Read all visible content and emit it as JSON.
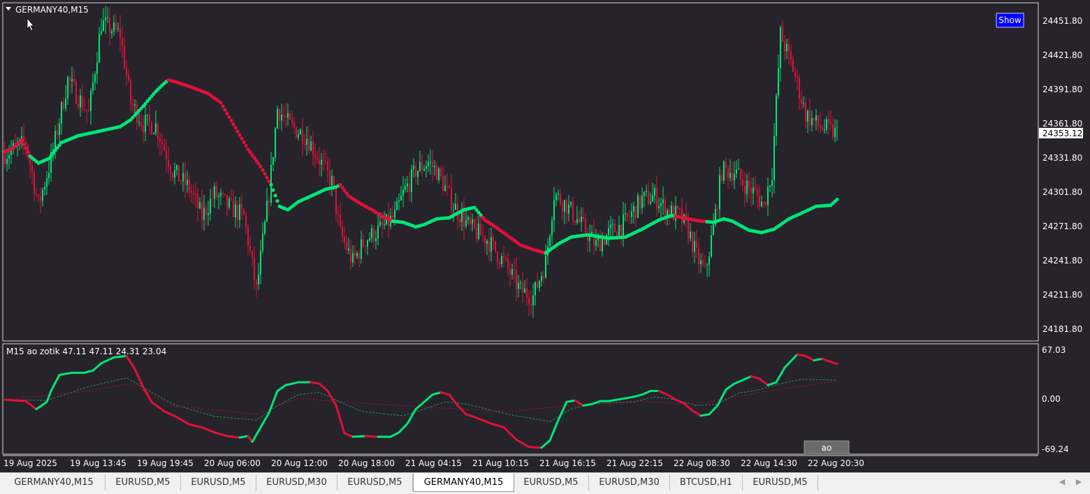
{
  "window": {
    "symbol_label": "GERMANY40,M15",
    "show_button": "Show"
  },
  "main_panel": {
    "price_labels": [
      "24451.80",
      "24421.80",
      "24391.80",
      "24361.80",
      "24331.80",
      "24301.80",
      "24271.80",
      "24241.80",
      "24211.80",
      "24181.80"
    ],
    "current_price": "24353.12"
  },
  "sub_panel": {
    "indicator_label": "M15 ao zotik  47.11 47.11 24.31 23.04",
    "axis_labels": [
      "67.03",
      "0.00",
      "-69.24"
    ],
    "ao_button": "ao"
  },
  "time_axis": [
    "19 Aug 2025",
    "19 Aug 13:45",
    "19 Aug 19:45",
    "20 Aug 06:00",
    "20 Aug 12:00",
    "20 Aug 18:00",
    "21 Aug 04:15",
    "21 Aug 10:15",
    "21 Aug 16:15",
    "21 Aug 22:15",
    "22 Aug 08:30",
    "22 Aug 14:30",
    "22 Aug 20:30"
  ],
  "tabs": [
    "GERMANY40,M15",
    "EURUSD,M5",
    "EURUSD,M5",
    "EURUSD,M30",
    "EURUSD,M5",
    "GERMANY40,M15",
    "EURUSD,M5",
    "EURUSD,M30",
    "BTCUSD,H1",
    "EURUSD,M5"
  ],
  "active_tab_index": 5,
  "colors": {
    "background": "#26232b",
    "bull": "#00e676",
    "bear": "#e0103a",
    "axis_text": "#ffffff",
    "show_button": "#0000ff"
  },
  "chart_data": {
    "type": "line",
    "instrument": "GERMANY40,M15",
    "y_range": [
      24170,
      24465
    ],
    "price_trendline": {
      "points": [
        [
          0,
          24337
        ],
        [
          4,
          24340
        ],
        [
          8,
          24347
        ],
        [
          12,
          24333
        ],
        [
          16,
          24327
        ],
        [
          21,
          24331
        ],
        [
          27,
          24345
        ],
        [
          35,
          24351
        ],
        [
          45,
          24355
        ],
        [
          55,
          24359
        ],
        [
          60,
          24365
        ],
        [
          66,
          24377
        ],
        [
          72,
          24390
        ],
        [
          76,
          24397
        ],
        [
          78,
          24400
        ],
        [
          82,
          24398
        ],
        [
          90,
          24393
        ],
        [
          97,
          24388
        ],
        [
          103,
          24380
        ],
        [
          110,
          24358
        ],
        [
          116,
          24339
        ],
        [
          122,
          24324
        ],
        [
          127,
          24308
        ],
        [
          131,
          24289
        ],
        [
          135,
          24286
        ],
        [
          140,
          24293
        ],
        [
          146,
          24298
        ],
        [
          153,
          24304
        ],
        [
          158,
          24306
        ],
        [
          160,
          24308
        ],
        [
          164,
          24298
        ],
        [
          170,
          24291
        ],
        [
          176,
          24285
        ],
        [
          180,
          24280
        ],
        [
          185,
          24276
        ],
        [
          190,
          24275
        ],
        [
          196,
          24271
        ],
        [
          200,
          24273
        ],
        [
          206,
          24278
        ],
        [
          212,
          24279
        ],
        [
          219,
          24286
        ],
        [
          224,
          24288
        ],
        [
          229,
          24277
        ],
        [
          234,
          24271
        ],
        [
          240,
          24263
        ],
        [
          246,
          24255
        ],
        [
          252,
          24251
        ],
        [
          258,
          24248
        ],
        [
          264,
          24256
        ],
        [
          270,
          24262
        ],
        [
          278,
          24264
        ],
        [
          288,
          24261
        ],
        [
          296,
          24262
        ],
        [
          304,
          24269
        ],
        [
          312,
          24277
        ],
        [
          318,
          24281
        ],
        [
          326,
          24278
        ],
        [
          332,
          24276
        ],
        [
          338,
          24275
        ],
        [
          343,
          24278
        ],
        [
          347,
          24276
        ],
        [
          351,
          24272
        ],
        [
          355,
          24268
        ],
        [
          361,
          24266
        ],
        [
          367,
          24269
        ],
        [
          374,
          24278
        ],
        [
          380,
          24283
        ],
        [
          387,
          24289
        ],
        [
          394,
          24290
        ],
        [
          397,
          24295
        ]
      ],
      "trend_segments": [
        {
          "from": 0,
          "to": 12,
          "trend": "bear"
        },
        {
          "from": 12,
          "to": 78,
          "trend": "bull"
        },
        {
          "from": 78,
          "to": 127,
          "trend": "bear"
        },
        {
          "from": 127,
          "to": 160,
          "trend": "bull"
        },
        {
          "from": 160,
          "to": 185,
          "trend": "bear"
        },
        {
          "from": 185,
          "to": 228,
          "trend": "bull"
        },
        {
          "from": 228,
          "to": 258,
          "trend": "bear"
        },
        {
          "from": 258,
          "to": 304,
          "trend": "bull"
        },
        {
          "from": 304,
          "to": 320,
          "trend": "bull"
        },
        {
          "from": 320,
          "to": 335,
          "trend": "bear"
        },
        {
          "from": 335,
          "to": 362,
          "trend": "bull"
        },
        {
          "from": 362,
          "to": 397,
          "trend": "bull"
        }
      ]
    },
    "candle_path": [
      [
        0,
        24335
      ],
      [
        10,
        24345
      ],
      [
        16,
        24290
      ],
      [
        22,
        24330
      ],
      [
        30,
        24400
      ],
      [
        40,
        24370
      ],
      [
        46,
        24450
      ],
      [
        55,
        24440
      ],
      [
        60,
        24380
      ],
      [
        66,
        24362
      ],
      [
        72,
        24360
      ],
      [
        80,
        24320
      ],
      [
        88,
        24305
      ],
      [
        94,
        24280
      ],
      [
        100,
        24300
      ],
      [
        106,
        24290
      ],
      [
        114,
        24280
      ],
      [
        120,
        24215
      ],
      [
        126,
        24300
      ],
      [
        130,
        24375
      ],
      [
        136,
        24360
      ],
      [
        144,
        24350
      ],
      [
        150,
        24330
      ],
      [
        156,
        24310
      ],
      [
        160,
        24265
      ],
      [
        166,
        24240
      ],
      [
        172,
        24260
      ],
      [
        180,
        24270
      ],
      [
        186,
        24280
      ],
      [
        190,
        24300
      ],
      [
        196,
        24320
      ],
      [
        202,
        24328
      ],
      [
        206,
        24320
      ],
      [
        214,
        24290
      ],
      [
        222,
        24270
      ],
      [
        230,
        24260
      ],
      [
        238,
        24240
      ],
      [
        246,
        24215
      ],
      [
        252,
        24210
      ],
      [
        258,
        24240
      ],
      [
        262,
        24300
      ],
      [
        268,
        24290
      ],
      [
        276,
        24270
      ],
      [
        282,
        24255
      ],
      [
        288,
        24265
      ],
      [
        296,
        24275
      ],
      [
        304,
        24295
      ],
      [
        310,
        24298
      ],
      [
        316,
        24285
      ],
      [
        322,
        24280
      ],
      [
        326,
        24268
      ],
      [
        330,
        24245
      ],
      [
        334,
        24230
      ],
      [
        338,
        24270
      ],
      [
        342,
        24320
      ],
      [
        348,
        24320
      ],
      [
        352,
        24310
      ],
      [
        358,
        24300
      ],
      [
        362,
        24290
      ],
      [
        366,
        24320
      ],
      [
        370,
        24440
      ],
      [
        376,
        24410
      ],
      [
        382,
        24370
      ],
      [
        388,
        24360
      ],
      [
        394,
        24355
      ],
      [
        397,
        24353
      ]
    ],
    "oscillator": {
      "label": "M15 ao zotik",
      "values_shown": [
        47.11,
        47.11,
        24.31,
        23.04
      ],
      "y_range": [
        -69.24,
        67.03
      ],
      "ao_line": [
        [
          0,
          -2
        ],
        [
          5,
          -3
        ],
        [
          10,
          -4
        ],
        [
          15,
          -15
        ],
        [
          20,
          -5
        ],
        [
          22,
          10
        ],
        [
          26,
          32
        ],
        [
          32,
          35
        ],
        [
          38,
          35
        ],
        [
          42,
          38
        ],
        [
          46,
          48
        ],
        [
          52,
          56
        ],
        [
          58,
          58
        ],
        [
          62,
          40
        ],
        [
          66,
          15
        ],
        [
          70,
          -5
        ],
        [
          76,
          -18
        ],
        [
          82,
          -26
        ],
        [
          88,
          -36
        ],
        [
          94,
          -40
        ],
        [
          100,
          -47
        ],
        [
          106,
          -52
        ],
        [
          112,
          -54
        ],
        [
          116,
          -52
        ],
        [
          118,
          -60
        ],
        [
          122,
          -40
        ],
        [
          126,
          -20
        ],
        [
          130,
          10
        ],
        [
          134,
          18
        ],
        [
          140,
          22
        ],
        [
          146,
          22
        ],
        [
          150,
          20
        ],
        [
          154,
          10
        ],
        [
          158,
          -10
        ],
        [
          162,
          -48
        ],
        [
          166,
          -53
        ],
        [
          172,
          -52
        ],
        [
          178,
          -53
        ],
        [
          184,
          -53
        ],
        [
          188,
          -47
        ],
        [
          192,
          -35
        ],
        [
          196,
          -15
        ],
        [
          200,
          -5
        ],
        [
          204,
          5
        ],
        [
          208,
          8
        ],
        [
          212,
          5
        ],
        [
          216,
          -10
        ],
        [
          220,
          -22
        ],
        [
          226,
          -28
        ],
        [
          232,
          -35
        ],
        [
          238,
          -40
        ],
        [
          244,
          -57
        ],
        [
          250,
          -67
        ],
        [
          256,
          -68
        ],
        [
          260,
          -58
        ],
        [
          264,
          -30
        ],
        [
          268,
          -5
        ],
        [
          272,
          -3
        ],
        [
          276,
          -10
        ],
        [
          280,
          -8
        ],
        [
          284,
          -4
        ],
        [
          288,
          -4
        ],
        [
          292,
          -2
        ],
        [
          296,
          0
        ],
        [
          300,
          2
        ],
        [
          304,
          5
        ],
        [
          308,
          10
        ],
        [
          312,
          10
        ],
        [
          316,
          5
        ],
        [
          320,
          -2
        ],
        [
          324,
          -7
        ],
        [
          328,
          -17
        ],
        [
          332,
          -24
        ],
        [
          336,
          -22
        ],
        [
          340,
          -10
        ],
        [
          344,
          12
        ],
        [
          348,
          20
        ],
        [
          352,
          25
        ],
        [
          356,
          30
        ],
        [
          360,
          27
        ],
        [
          364,
          18
        ],
        [
          368,
          22
        ],
        [
          372,
          42
        ],
        [
          378,
          60
        ],
        [
          382,
          58
        ],
        [
          386,
          52
        ],
        [
          390,
          54
        ],
        [
          394,
          50
        ],
        [
          397,
          47
        ]
      ],
      "signal_line": [
        [
          0,
          -2
        ],
        [
          20,
          -3
        ],
        [
          40,
          16
        ],
        [
          58,
          28
        ],
        [
          66,
          15
        ],
        [
          80,
          -8
        ],
        [
          100,
          -25
        ],
        [
          120,
          -30
        ],
        [
          130,
          -10
        ],
        [
          140,
          5
        ],
        [
          150,
          8
        ],
        [
          160,
          -5
        ],
        [
          170,
          -18
        ],
        [
          190,
          -24
        ],
        [
          200,
          -15
        ],
        [
          210,
          -5
        ],
        [
          220,
          -8
        ],
        [
          240,
          -22
        ],
        [
          260,
          -32
        ],
        [
          270,
          -15
        ],
        [
          280,
          -8
        ],
        [
          300,
          -5
        ],
        [
          310,
          2
        ],
        [
          320,
          -2
        ],
        [
          330,
          -10
        ],
        [
          340,
          -8
        ],
        [
          350,
          7
        ],
        [
          360,
          12
        ],
        [
          370,
          20
        ],
        [
          380,
          26
        ],
        [
          397,
          25
        ]
      ],
      "signal_line_2": [
        [
          0,
          -2
        ],
        [
          40,
          10
        ],
        [
          60,
          20
        ],
        [
          80,
          -10
        ],
        [
          120,
          -22
        ],
        [
          140,
          0
        ],
        [
          160,
          -5
        ],
        [
          200,
          -12
        ],
        [
          240,
          -18
        ],
        [
          270,
          -10
        ],
        [
          300,
          -4
        ],
        [
          330,
          -8
        ],
        [
          360,
          8
        ],
        [
          397,
          24
        ]
      ]
    }
  }
}
